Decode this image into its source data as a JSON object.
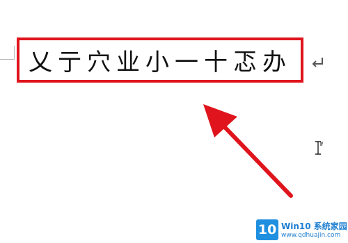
{
  "document": {
    "selected_text": "乂亍穴业小一十忑办"
  },
  "annotation": {
    "highlight_color": "#e0141c",
    "arrow_color": "#e0141c"
  },
  "watermark": {
    "logo_text": "10",
    "title": "Win10 系统家园",
    "url": "www.qdhuajin.com",
    "color": "#1f7fd0"
  },
  "icons": {
    "paragraph_mark": "paragraph-return-icon",
    "cursor": "i-beam-cursor-icon"
  }
}
